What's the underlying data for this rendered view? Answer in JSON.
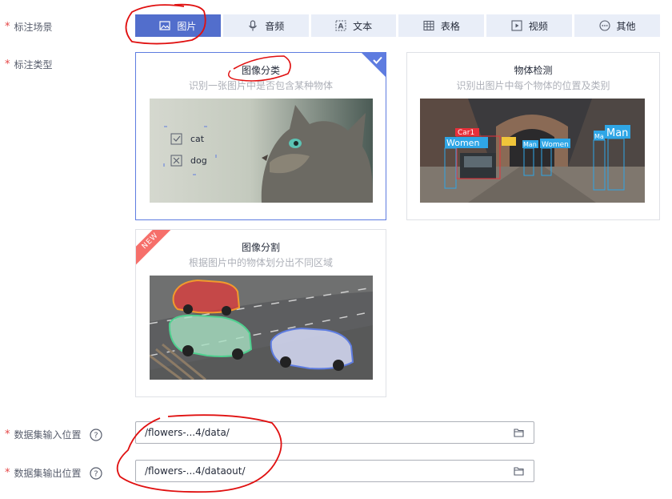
{
  "form": {
    "scene_label": "标注场景",
    "type_label": "标注类型",
    "input_label": "数据集输入位置",
    "output_label": "数据集输出位置",
    "required_mark": "*"
  },
  "scenes": [
    {
      "label": "图片",
      "icon": "image-icon",
      "active": true
    },
    {
      "label": "音频",
      "icon": "microphone-icon",
      "active": false
    },
    {
      "label": "文本",
      "icon": "text-icon",
      "active": false
    },
    {
      "label": "表格",
      "icon": "table-icon",
      "active": false
    },
    {
      "label": "视频",
      "icon": "video-icon",
      "active": false
    },
    {
      "label": "其他",
      "icon": "more-icon",
      "active": false
    }
  ],
  "cards": {
    "classification": {
      "title": "图像分类",
      "desc": "识别一张图片中是否包含某种物体",
      "options": [
        "cat",
        "dog"
      ],
      "selected": true
    },
    "detection": {
      "title": "物体检测",
      "desc": "识别出图片中每个物体的位置及类别",
      "labels": [
        "Car1",
        "Women",
        "Man",
        "Women",
        "Ma",
        "Man"
      ]
    },
    "segmentation": {
      "title": "图像分割",
      "desc": "根据图片中的物体划分出不同区域",
      "badge": "NEW"
    }
  },
  "paths": {
    "input": "/flowers-...4/data/",
    "output": "/flowers-...4/dataout/"
  },
  "colors": {
    "accent": "#526ecc",
    "tab_bg": "#e9eef8",
    "required": "#e54545",
    "new_badge": "#f66f6a",
    "annotation": "#e01010"
  }
}
